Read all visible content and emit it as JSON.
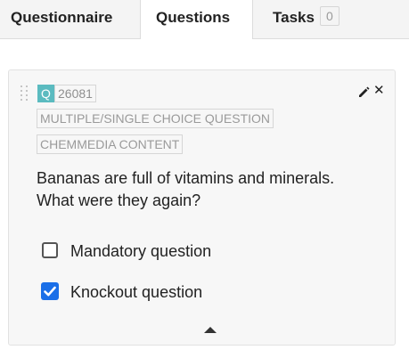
{
  "tabs": [
    {
      "label": "Questionnaire",
      "active": false
    },
    {
      "label": "Questions",
      "active": true
    },
    {
      "label": "Tasks",
      "active": false,
      "count": "0"
    }
  ],
  "question": {
    "badge": "Q",
    "id": "26081",
    "tags": [
      "MULTIPLE/SINGLE CHOICE QUESTION",
      "CHEMMEDIA CONTENT"
    ],
    "text": "Bananas are full of vitamins and minerals. What were they again?",
    "options": [
      {
        "label": "Mandatory question",
        "checked": false
      },
      {
        "label": "Knockout question",
        "checked": true
      }
    ],
    "icons": {
      "drag": "drag-handle-icon",
      "edit": "pencil-icon",
      "close": "close-icon",
      "collapse": "caret-up-icon"
    }
  },
  "colors": {
    "badge": "#5bbbc0",
    "checkbox_checked": "#1a6fe8",
    "inactive_tab_bg": "#f4f4f4",
    "card_bg": "#f7f7f7"
  }
}
